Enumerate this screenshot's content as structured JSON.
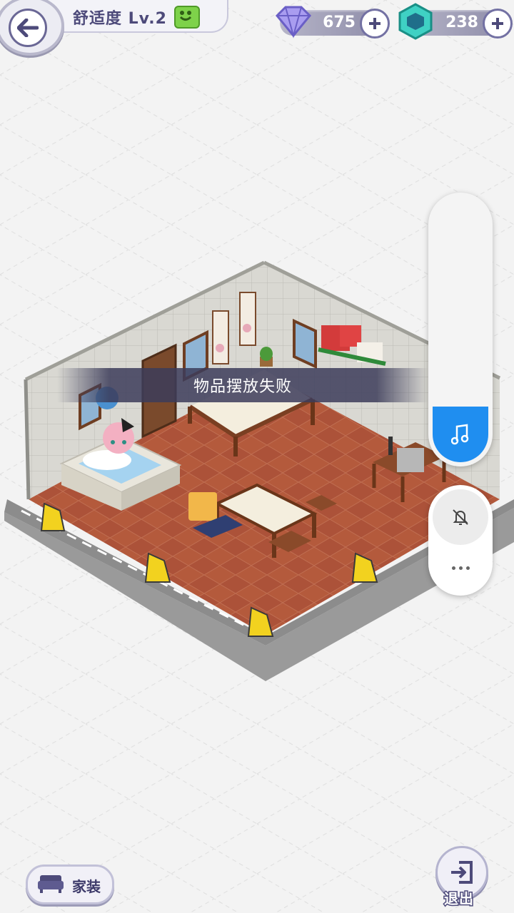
{
  "header": {
    "comfort_label": "舒适度 Lv.2"
  },
  "currency": {
    "diamonds": "675",
    "crystals": "238"
  },
  "toast": {
    "message": "物品摆放失败"
  },
  "bottom": {
    "furnish_label": "家装",
    "exit_label": "退出"
  },
  "colors": {
    "accent": "#4d4a7a",
    "volume_blue": "#1f8ef0",
    "floor": "#b0593c"
  }
}
